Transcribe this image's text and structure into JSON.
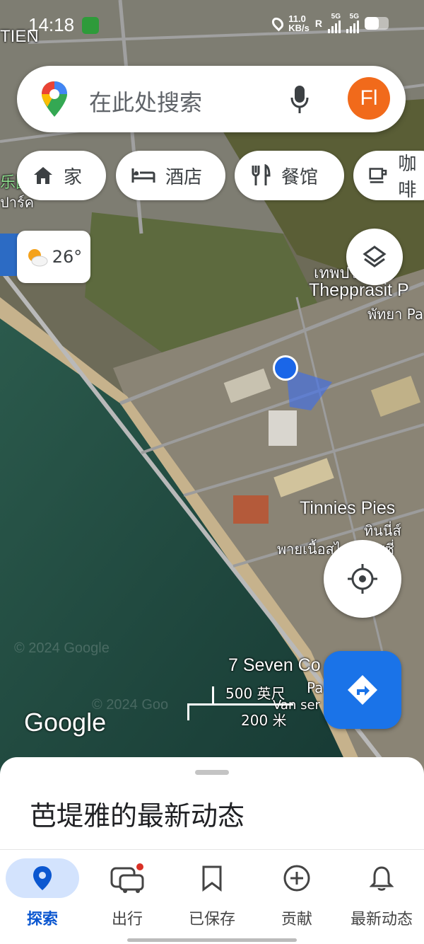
{
  "status_bar": {
    "time": "14:18",
    "speed_top": "11.0",
    "speed_unit": "KB/s",
    "roaming": "R",
    "net1": "5G",
    "net2": "5G"
  },
  "search": {
    "placeholder": "在此处搜索",
    "avatar_text": "Fl"
  },
  "chips": [
    {
      "label": "家",
      "icon": "home-icon"
    },
    {
      "label": "酒店",
      "icon": "bed-icon"
    },
    {
      "label": "餐馆",
      "icon": "fork-knife-icon"
    },
    {
      "label": "咖啡",
      "icon": "coffee-cup-icon"
    }
  ],
  "weather": {
    "temp": "26°",
    "icon": "partly-cloudy-icon"
  },
  "map_labels": {
    "top_left": "TIEN",
    "left_text1": "乐园",
    "left_text2": "ปาร์ค",
    "thai1": "เทพประสิทธิ์",
    "poi1": "Thepprasit P",
    "thai2": "พัทยา Pa",
    "poi2": "Tinnies Pies",
    "thai3": "ทินนี่ส์",
    "thai4": "พายเนื้อสไตล์ออสซี่",
    "poi3": "7 Seven Co",
    "poi3_sub1": "Pa",
    "poi3_sub2": "Van ser",
    "watermark1": "© 2024 Google",
    "watermark2": "© 2024 Goo",
    "google_logo": "Google"
  },
  "scale": {
    "imperial": "500 英尺",
    "metric": "200 米"
  },
  "sheet": {
    "title": "芭堤雅的最新动态"
  },
  "nav": [
    {
      "label": "探索",
      "icon": "location-pin-icon",
      "active": true
    },
    {
      "label": "出行",
      "icon": "car-icon",
      "active": false
    },
    {
      "label": "已保存",
      "icon": "bookmark-icon",
      "active": false
    },
    {
      "label": "贡献",
      "icon": "add-circle-icon",
      "active": false
    },
    {
      "label": "最新动态",
      "icon": "bell-icon",
      "active": false
    }
  ],
  "colors": {
    "accent": "#1a73e8",
    "avatar": "#f16a1b",
    "sea": "#1f4a44",
    "land": "#5a6a45"
  }
}
